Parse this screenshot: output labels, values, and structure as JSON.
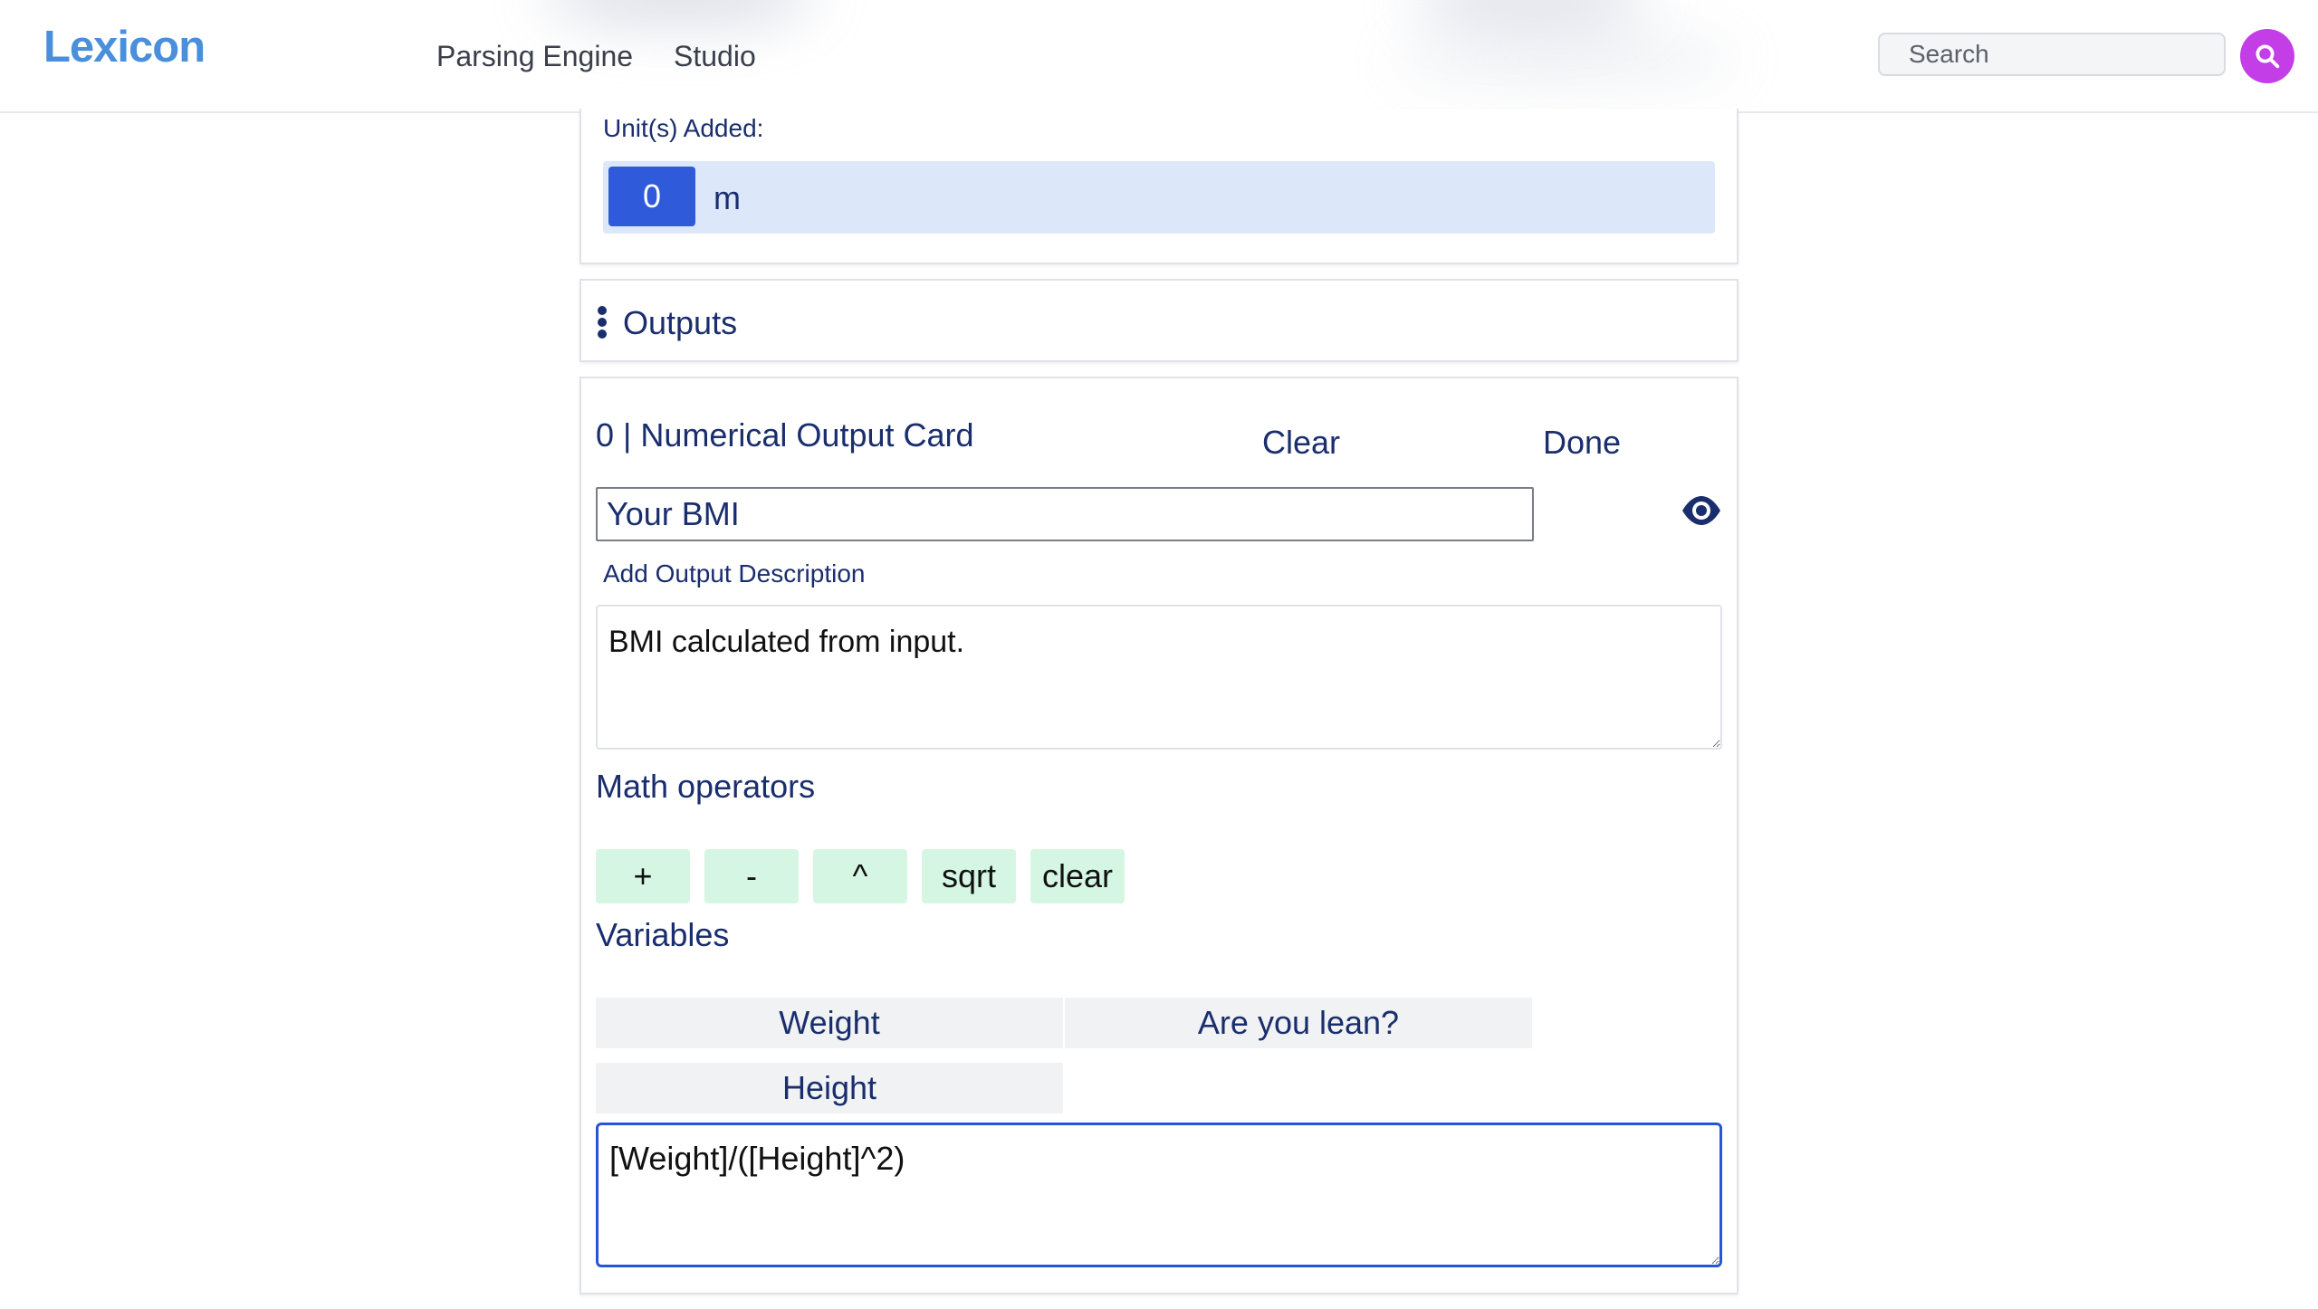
{
  "nav": {
    "logo": "Lexicon",
    "links": [
      "Parsing Engine",
      "Studio"
    ],
    "search_placeholder": "Search"
  },
  "units": {
    "label": "Unit(s) Added:",
    "items": [
      {
        "badge": "0",
        "name": "m"
      }
    ]
  },
  "outputs": {
    "title": "Outputs"
  },
  "output_card": {
    "title": "0 | Numerical Output Card",
    "clear_label": "Clear",
    "done_label": "Done",
    "name_value": "Your BMI",
    "description_label": "Add Output Description",
    "description_value": "BMI calculated from input.",
    "math_label": "Math operators",
    "operators": [
      "+",
      "-",
      "^",
      "sqrt",
      "clear"
    ],
    "variables_label": "Variables",
    "variables": [
      "Weight",
      "Are you lean?",
      "Height"
    ],
    "formula_value": "[Weight]/([Height]^2)"
  },
  "colors": {
    "logo": "#4a8fdc",
    "accent": "#2f5bdb",
    "search_button": "#c43ee8",
    "operator_bg": "#d6f6e4",
    "text": "#1a2e6e"
  }
}
